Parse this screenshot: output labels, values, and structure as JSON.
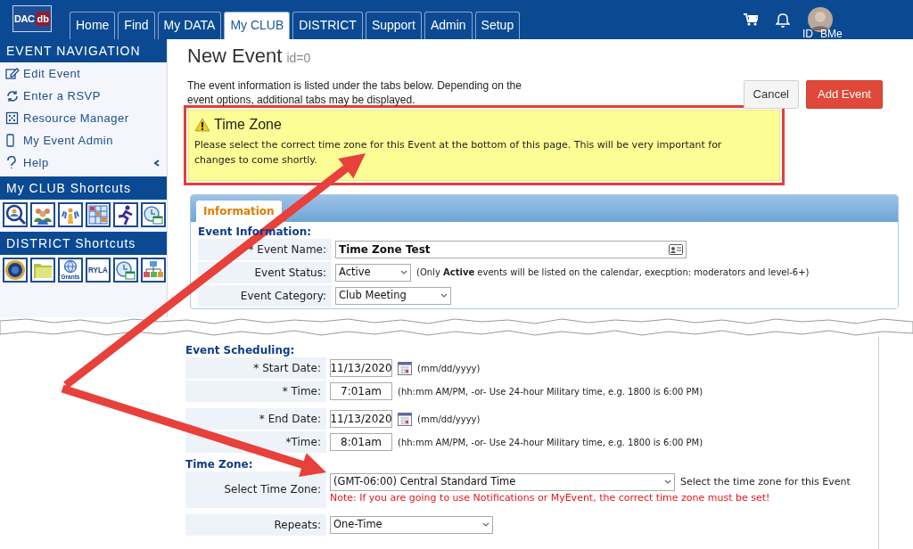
{
  "navbar": {
    "logo": {
      "left": "DAC",
      "right": "db"
    },
    "tabs": [
      {
        "label": "Home",
        "selected": false
      },
      {
        "label": "Find",
        "selected": false
      },
      {
        "label": "My DATA",
        "selected": false
      },
      {
        "label": "My CLUB",
        "selected": true
      },
      {
        "label": "DISTRICT",
        "selected": false
      },
      {
        "label": "Support",
        "selected": false
      },
      {
        "label": "Admin",
        "selected": false
      },
      {
        "label": "Setup",
        "selected": false
      }
    ],
    "user": {
      "id_label": "ID",
      "name": "BMe"
    }
  },
  "sidebar": {
    "sections": [
      {
        "title": "EVENT NAVIGATION",
        "kind": "links",
        "items": [
          {
            "label": "Edit Event"
          },
          {
            "label": "Enter a RSVP"
          },
          {
            "label": "Resource Manager"
          },
          {
            "label": "My Event Admin"
          },
          {
            "label": "Help",
            "expanded": false
          }
        ]
      },
      {
        "title": "My CLUB Shortcuts",
        "kind": "icons",
        "items": [
          {
            "kind": "person-search"
          },
          {
            "kind": "group"
          },
          {
            "kind": "crowd"
          },
          {
            "kind": "chart"
          },
          {
            "kind": "runner"
          },
          {
            "kind": "clock"
          }
        ]
      },
      {
        "title": "DISTRICT Shortcuts",
        "kind": "icons",
        "items": [
          {
            "kind": "seal"
          },
          {
            "kind": "folder"
          },
          {
            "kind": "globe",
            "caption": "Grants"
          },
          {
            "kind": "logo",
            "caption": "RYLA"
          },
          {
            "kind": "clock"
          },
          {
            "kind": "org"
          }
        ]
      }
    ]
  },
  "page": {
    "title": "New Event",
    "id_text": "id=0",
    "intro": "The event information is listed under the tabs below. Depending on the event options, additional tabs may be displayed.",
    "buttons": [
      {
        "label": "Cancel",
        "kind": "secondary"
      },
      {
        "label": "Add Event",
        "kind": "primary"
      }
    ],
    "callout": {
      "title": "Time Zone",
      "text": "Please select the correct time zone for this Event at the bottom of this page. This will be very important for changes to come shortly."
    },
    "tabs": [
      {
        "label": "Information",
        "selected": true
      }
    ],
    "sections": [
      {
        "heading": "Event Information:",
        "groups": [
          {
            "rows": [
              {
                "label": "* Event Name:",
                "kind": "text",
                "value": "Time Zone Test"
              },
              {
                "label": "Event Status:",
                "kind": "select",
                "value": "Active",
                "hint": "(Only **Active** events will be listed on the calendar, execption: moderators and level-6+)"
              },
              {
                "label": "Event Category:",
                "kind": "select",
                "value": "Club Meeting"
              }
            ]
          }
        ]
      },
      {
        "heading": "Event Scheduling:",
        "groups": [
          {
            "rows": [
              {
                "label": "* Start Date:",
                "kind": "date",
                "value": "11/13/2020",
                "hint": "(mm/dd/yyyy)"
              },
              {
                "label": "* Time:",
                "kind": "time",
                "value": "7:01am",
                "hint": "(hh:mm AM/PM, -or- Use 24-hour Military time, e.g. 1800 is 6:00 PM)"
              }
            ]
          },
          {
            "rows": [
              {
                "label": "* End Date:",
                "kind": "date",
                "value": "11/13/2020",
                "hint": "(mm/dd/yyyy)"
              },
              {
                "label": "*Time:",
                "kind": "time",
                "value": "8:01am",
                "hint": "(hh:mm AM/PM, -or- Use 24-hour Military time, e.g. 1800 is 6:00 PM)"
              }
            ]
          }
        ]
      },
      {
        "heading": "Time Zone:",
        "groups": [
          {
            "rows": [
              {
                "label": "Select Time Zone:",
                "kind": "timezone",
                "value": "(GMT-06:00) Central Standard Time",
                "hint": "Select the time zone for this Event",
                "warning": "Note: If you are going to use Notifications or MyEvent, the correct time zone must be set!"
              }
            ]
          },
          {
            "rows": [
              {
                "label": "Repeats:",
                "kind": "select",
                "value": "One-Time"
              }
            ]
          }
        ]
      }
    ]
  }
}
